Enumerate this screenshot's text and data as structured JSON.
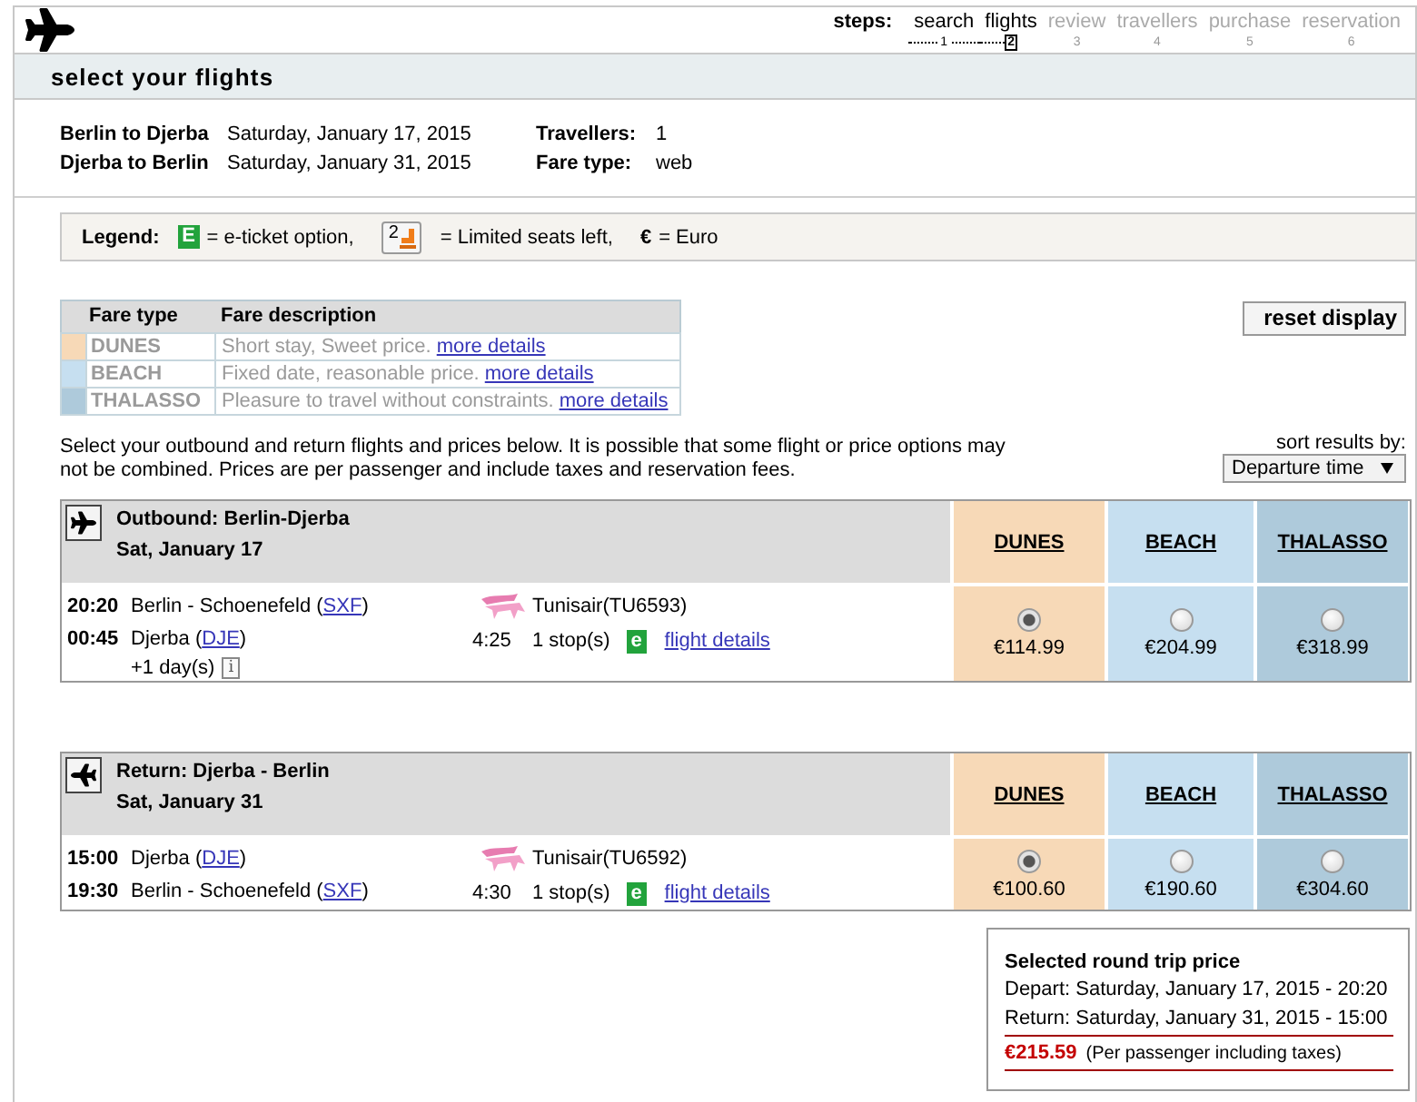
{
  "header": {
    "steps_label": "steps:",
    "steps": [
      {
        "label": "search",
        "number": "1",
        "disabled": false,
        "selected": false
      },
      {
        "label": "flights",
        "number": "2",
        "disabled": false,
        "selected": true
      },
      {
        "label": "review",
        "number": "3",
        "disabled": true,
        "selected": false
      },
      {
        "label": "travellers",
        "number": "4",
        "disabled": true,
        "selected": false
      },
      {
        "label": "purchase",
        "number": "5",
        "disabled": true,
        "selected": false
      },
      {
        "label": "reservation",
        "number": "6",
        "disabled": true,
        "selected": false
      }
    ]
  },
  "page_title": "select your flights",
  "trip": {
    "legs": [
      {
        "route": "Berlin to Djerba",
        "date": "Saturday, January 17, 2015"
      },
      {
        "route": "Djerba to Berlin",
        "date": "Saturday, January 31, 2015"
      }
    ],
    "details": [
      {
        "label": "Travellers:",
        "value": "1"
      },
      {
        "label": "Fare type:",
        "value": "web"
      }
    ]
  },
  "legend": {
    "label": "Legend:",
    "items": [
      {
        "kind": "eticket",
        "symbol": "E",
        "text": "= e-ticket option,"
      },
      {
        "kind": "seats",
        "symbol": "2",
        "text": "= Limited seats left,"
      },
      {
        "kind": "currency",
        "symbol": "€",
        "text": "= Euro"
      }
    ]
  },
  "fare_table": {
    "columns": [
      "Fare type",
      "Fare description"
    ],
    "rows": [
      {
        "name": "DUNES",
        "color": "#f7d9b7",
        "description": "Short stay, Sweet price.",
        "link": "more details"
      },
      {
        "name": "BEACH",
        "color": "#c6dff0",
        "description": "Fixed date, reasonable price.",
        "link": "more details"
      },
      {
        "name": "THALASSO",
        "color": "#aecadb",
        "description": "Pleasure to travel without constraints.",
        "link": "more details"
      }
    ]
  },
  "reset_button": "reset display",
  "intro": "Select your outbound and return flights and prices below. It is possible that some flight or price options may not be combined. Prices are per passenger and include taxes and reservation fees.",
  "sort": {
    "label": "sort results by:",
    "value": "Departure time"
  },
  "flights": [
    {
      "kind": "outbound",
      "title": "Outbound: Berlin-Djerba",
      "date": "Sat, January 17",
      "fares": [
        {
          "name": "DUNES",
          "color": "#f7d9b7"
        },
        {
          "name": "BEACH",
          "color": "#c6dff0"
        },
        {
          "name": "THALASSO",
          "color": "#aecadb"
        }
      ],
      "segments": [
        {
          "time": "20:20",
          "place": "Berlin - Schoenefeld (",
          "code": "SXF",
          "after": ")"
        },
        {
          "time": "00:45",
          "place": "Djerba (",
          "code": "DJE",
          "after": ")",
          "note": "+1 day(s)",
          "info": "i"
        }
      ],
      "airline": "Tunisair(TU6593)",
      "duration": "4:25",
      "stops": "1 stop(s)",
      "eticket": "e",
      "details_link": "flight details",
      "prices": [
        {
          "price": "€114.99",
          "selected": true
        },
        {
          "price": "€204.99",
          "selected": false
        },
        {
          "price": "€318.99",
          "selected": false
        }
      ]
    },
    {
      "kind": "return",
      "title": "Return: Djerba - Berlin",
      "date": "Sat, January 31",
      "fares": [
        {
          "name": "DUNES",
          "color": "#f7d9b7"
        },
        {
          "name": "BEACH",
          "color": "#c6dff0"
        },
        {
          "name": "THALASSO",
          "color": "#aecadb"
        }
      ],
      "segments": [
        {
          "time": "15:00",
          "place": "Djerba (",
          "code": "DJE",
          "after": ")"
        },
        {
          "time": "19:30",
          "place": "Berlin - Schoenefeld (",
          "code": "SXF",
          "after": ")"
        }
      ],
      "airline": "Tunisair(TU6592)",
      "duration": "4:30",
      "stops": "1 stop(s)",
      "eticket": "e",
      "details_link": "flight details",
      "prices": [
        {
          "price": "€100.60",
          "selected": true
        },
        {
          "price": "€190.60",
          "selected": false
        },
        {
          "price": "€304.60",
          "selected": false
        }
      ]
    }
  ],
  "summary": {
    "title": "Selected round trip price",
    "lines": [
      "Depart: Saturday, January 17, 2015 - 20:20",
      "Return: Saturday, January 31, 2015 - 15:00"
    ],
    "total": "€215.59",
    "note": "(Per passenger including taxes)"
  }
}
